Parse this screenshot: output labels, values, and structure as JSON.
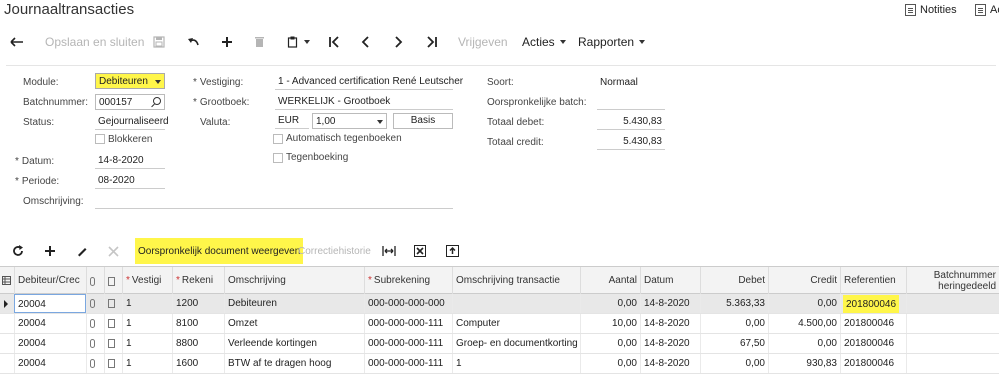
{
  "title": "Journaaltransacties",
  "top_actions": {
    "notities": "Notities",
    "acties": "Ac"
  },
  "toolbar": {
    "save_close": "Opslaan en sluiten",
    "vrijgeven": "Vrijgeven",
    "acties": "Acties",
    "rapporten": "Rapporten"
  },
  "form": {
    "module_label": "Module:",
    "module_value": "Debiteuren",
    "batchnummer_label": "Batchnummer:",
    "batchnummer_value": "000157",
    "status_label": "Status:",
    "status_value": "Gejournaliseerd",
    "blokkeren_label": "Blokkeren",
    "datum_label": "Datum:",
    "datum_value": "14-8-2020",
    "periode_label": "Periode:",
    "periode_value": "08-2020",
    "omschrijving_label": "Omschrijving:",
    "vestiging_label": "Vestiging:",
    "vestiging_value": "1 - Advanced certification René Leutscher",
    "grootboek_label": "Grootboek:",
    "grootboek_value": "WERKELIJK - Grootboek",
    "valuta_label": "Valuta:",
    "valuta_value": "EUR",
    "rate_value": "1,00",
    "basis_label": "Basis",
    "auto_tegen_label": "Automatisch tegenboeken",
    "tegenboeking_label": "Tegenboeking",
    "soort_label": "Soort:",
    "soort_value": "Normaal",
    "orig_batch_label": "Oorspronkelijke batch:",
    "totaal_debet_label": "Totaal debet:",
    "totaal_debet_value": "5.430,83",
    "totaal_credit_label": "Totaal credit:",
    "totaal_credit_value": "5.430,83"
  },
  "gridbar": {
    "orig_doc": "Oorspronkelijk document weergeven",
    "correctiehistorie": "Correctiehistorie"
  },
  "grid": {
    "headers": {
      "debiteur": "Debiteur/Crec",
      "vestiging": "Vestigi",
      "rekening": "Rekeni",
      "omschrijving": "Omschrijving",
      "subrekening": "Subrekening",
      "omschr_trans": "Omschrijving transactie",
      "aantal": "Aantal",
      "datum": "Datum",
      "debet": "Debet",
      "credit": "Credit",
      "referentien": "Referentien",
      "batch_her_1": "Batchnummer",
      "batch_her_2": "heringedeeld"
    },
    "rows": [
      {
        "debiteur": "20004",
        "vestiging": "1",
        "rekening": "1200",
        "omschrijving": "Debiteuren",
        "subrekening": "000-000-000-000",
        "omschr_trans": "",
        "aantal": "0,00",
        "datum": "14-8-2020",
        "debet": "5.363,33",
        "credit": "0,00",
        "referentie": "201800046"
      },
      {
        "debiteur": "20004",
        "vestiging": "1",
        "rekening": "8100",
        "omschrijving": "Omzet",
        "subrekening": "000-000-000-111",
        "omschr_trans": "Computer",
        "aantal": "10,00",
        "datum": "14-8-2020",
        "debet": "0,00",
        "credit": "4.500,00",
        "referentie": "201800046"
      },
      {
        "debiteur": "20004",
        "vestiging": "1",
        "rekening": "8800",
        "omschrijving": "Verleende kortingen",
        "subrekening": "000-000-000-111",
        "omschr_trans": "Groep- en documentkorting",
        "aantal": "0,00",
        "datum": "14-8-2020",
        "debet": "67,50",
        "credit": "0,00",
        "referentie": "201800046"
      },
      {
        "debiteur": "20004",
        "vestiging": "1",
        "rekening": "1600",
        "omschrijving": "BTW af te dragen hoog",
        "subrekening": "000-000-000-111",
        "omschr_trans": "1",
        "aantal": "0,00",
        "datum": "14-8-2020",
        "debet": "0,00",
        "credit": "930,83",
        "referentie": "201800046"
      }
    ]
  },
  "colors": {
    "highlight": "#fff64a",
    "selected_row": "#e8e8e8",
    "required": "#cc3333"
  }
}
